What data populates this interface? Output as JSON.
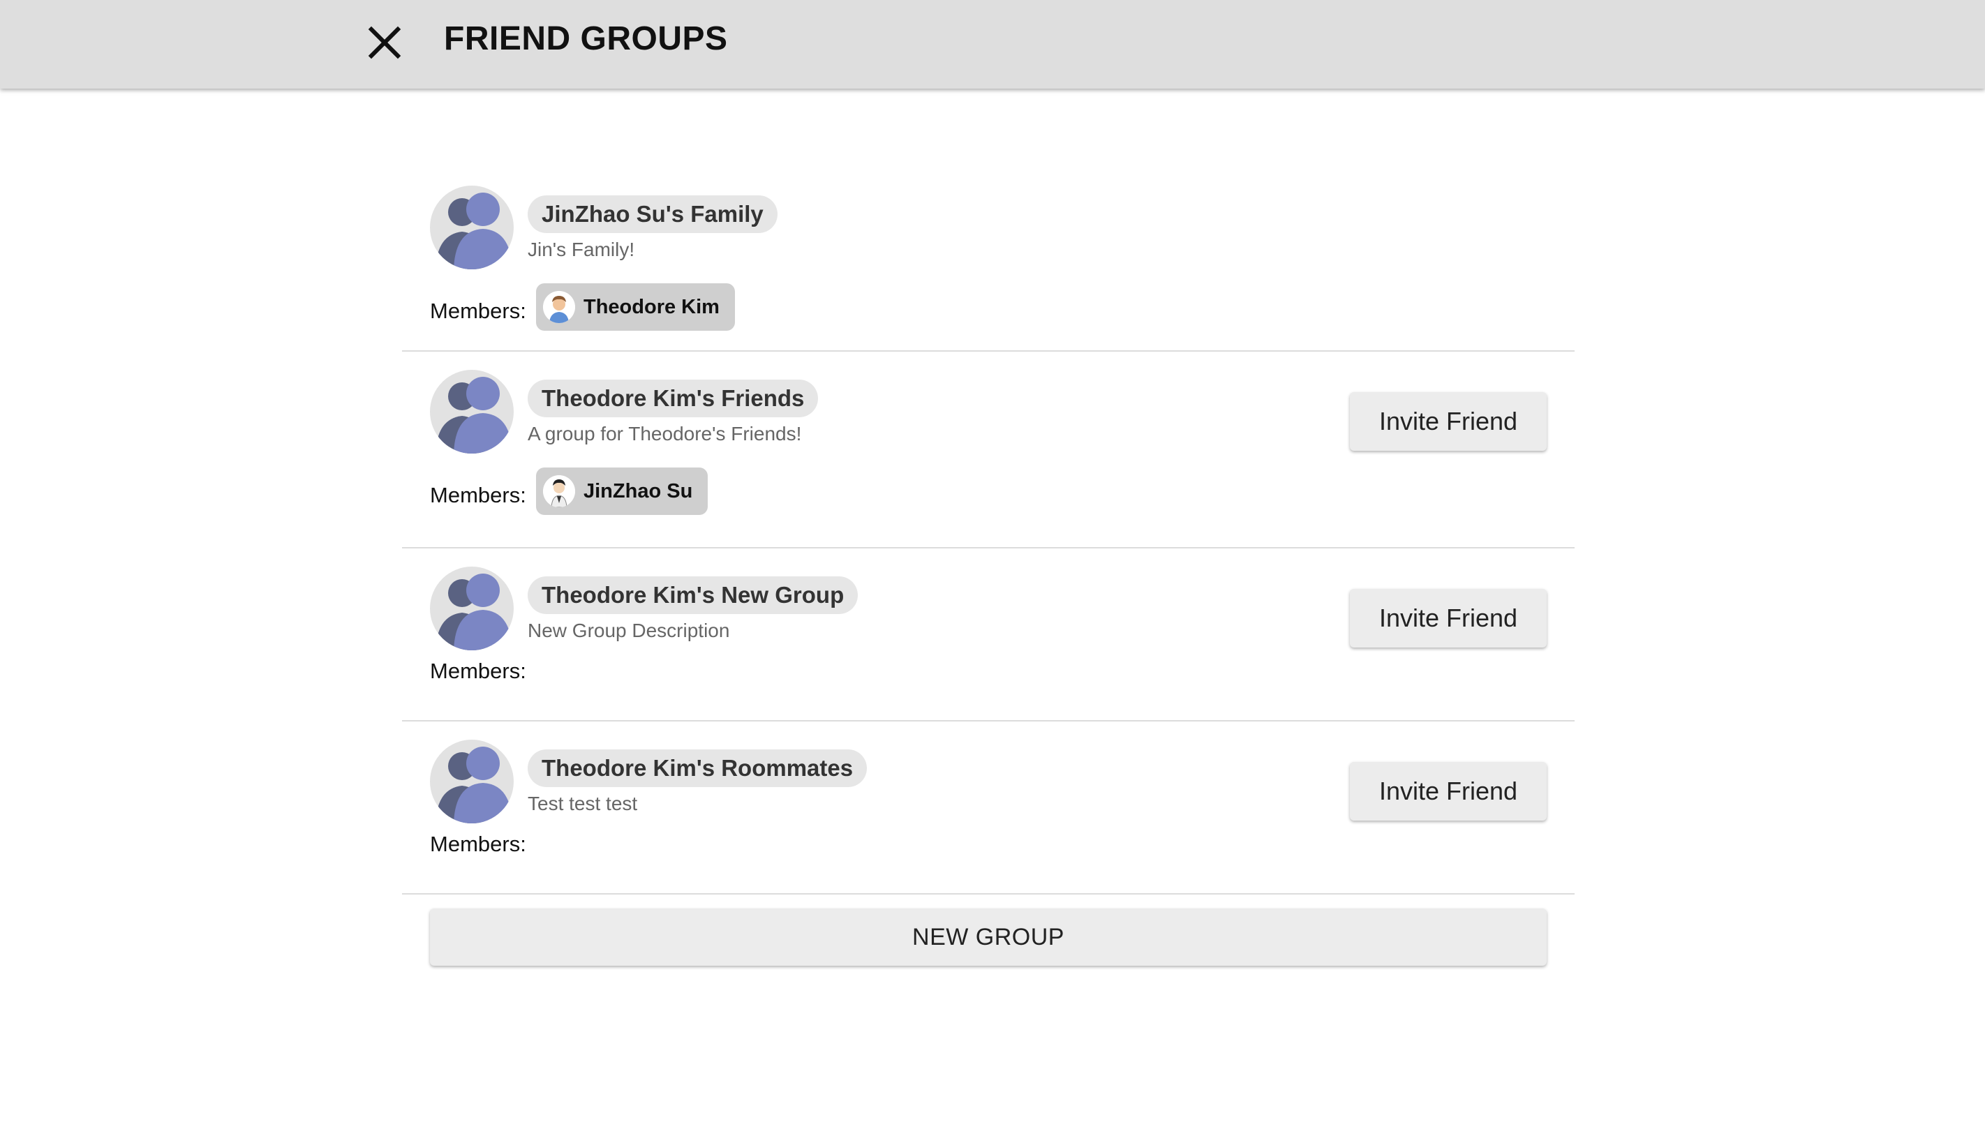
{
  "header": {
    "title": "FRIEND GROUPS",
    "close_icon": "close-icon"
  },
  "groups": [
    {
      "name": "JinZhao Su's Family",
      "description": "Jin's Family!",
      "members_label": "Members:",
      "members": [
        {
          "name": "Theodore Kim",
          "avatar": "user-avatar-icon"
        }
      ],
      "invite_label": ""
    },
    {
      "name": "Theodore Kim's Friends",
      "description": "A group for Theodore's Friends!",
      "members_label": "Members:",
      "members": [
        {
          "name": "JinZhao Su",
          "avatar": "user-avatar-icon"
        }
      ],
      "invite_label": "Invite Friend"
    },
    {
      "name": "Theodore Kim's New Group",
      "description": "New Group Description",
      "members_label": "Members:",
      "members": [],
      "invite_label": "Invite Friend"
    },
    {
      "name": "Theodore Kim's Roommates",
      "description": "Test test test",
      "members_label": "Members:",
      "members": [],
      "invite_label": "Invite Friend"
    }
  ],
  "new_group_label": "NEW GROUP",
  "colors": {
    "header_bg": "#dedede",
    "chip_bg": "#e6e6e6",
    "member_chip_bg": "#cfcfcf",
    "avatar_front": "#7b86c4",
    "avatar_back": "#5a6282"
  }
}
